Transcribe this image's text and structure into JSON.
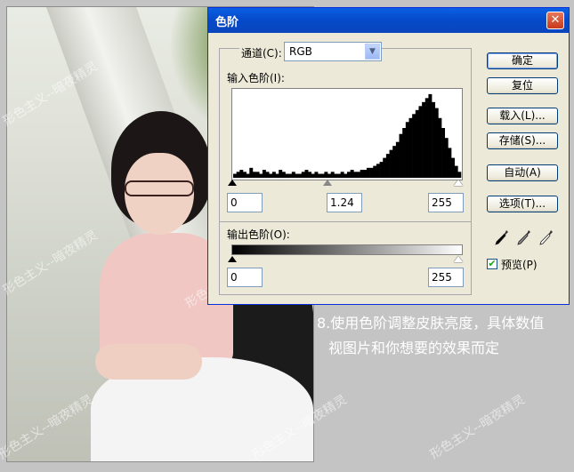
{
  "dialog": {
    "title": "色阶",
    "channel_label": "通道(C):",
    "channel_value": "RGB",
    "input_levels_label": "输入色阶(I):",
    "input_black": "0",
    "input_gamma": "1.24",
    "input_white": "255",
    "output_levels_label": "输出色阶(O):",
    "output_black": "0",
    "output_white": "255",
    "buttons": {
      "ok": "确定",
      "reset": "复位",
      "load": "载入(L)...",
      "save": "存储(S)...",
      "auto": "自动(A)",
      "options": "选项(T)..."
    },
    "preview_label": "预览(P)",
    "preview_checked": true,
    "eyedroppers": [
      "black-eyedropper-icon",
      "gray-eyedropper-icon",
      "white-eyedropper-icon"
    ]
  },
  "histogram": [
    2,
    3,
    4,
    3,
    2,
    5,
    3,
    3,
    2,
    4,
    3,
    2,
    3,
    2,
    4,
    3,
    2,
    2,
    3,
    2,
    2,
    3,
    4,
    3,
    2,
    3,
    2,
    2,
    3,
    2,
    3,
    2,
    2,
    3,
    2,
    3,
    4,
    3,
    3,
    4,
    4,
    5,
    5,
    6,
    7,
    8,
    10,
    12,
    14,
    16,
    18,
    22,
    25,
    28,
    30,
    32,
    34,
    36,
    38,
    40,
    42,
    38,
    35,
    30,
    25,
    20,
    15,
    10,
    6,
    3
  ],
  "caption": {
    "line1": "8.使用色阶调整皮肤亮度，具体数值",
    "line2": "视图片和你想要的效果而定"
  },
  "watermarks": [
    "形色主义--暗夜精灵",
    "形色主义--暗夜精灵",
    "形色主义--暗夜精灵",
    "形色主义--暗夜精灵",
    "形色主义--暗夜精灵",
    "形色主义--暗夜精灵"
  ]
}
